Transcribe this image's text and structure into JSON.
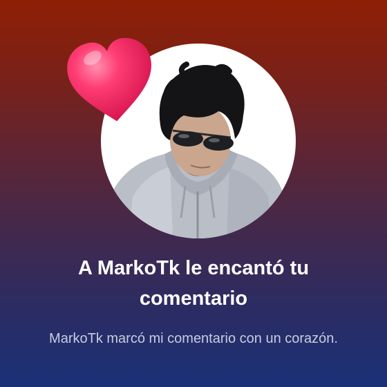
{
  "notification": {
    "title": "A MarkoTk le encantó tu comentario",
    "description": "MarkoTk marcó mi comentario con un corazón.",
    "avatar_icon": "user-avatar-photo",
    "reaction_icon": "heart-icon"
  },
  "colors": {
    "background_top": "#8e1f05",
    "background_bottom": "#1a3178",
    "heart": "#ff2f6b",
    "title_text": "#ffffff",
    "description_text": "#c9ccdd"
  }
}
